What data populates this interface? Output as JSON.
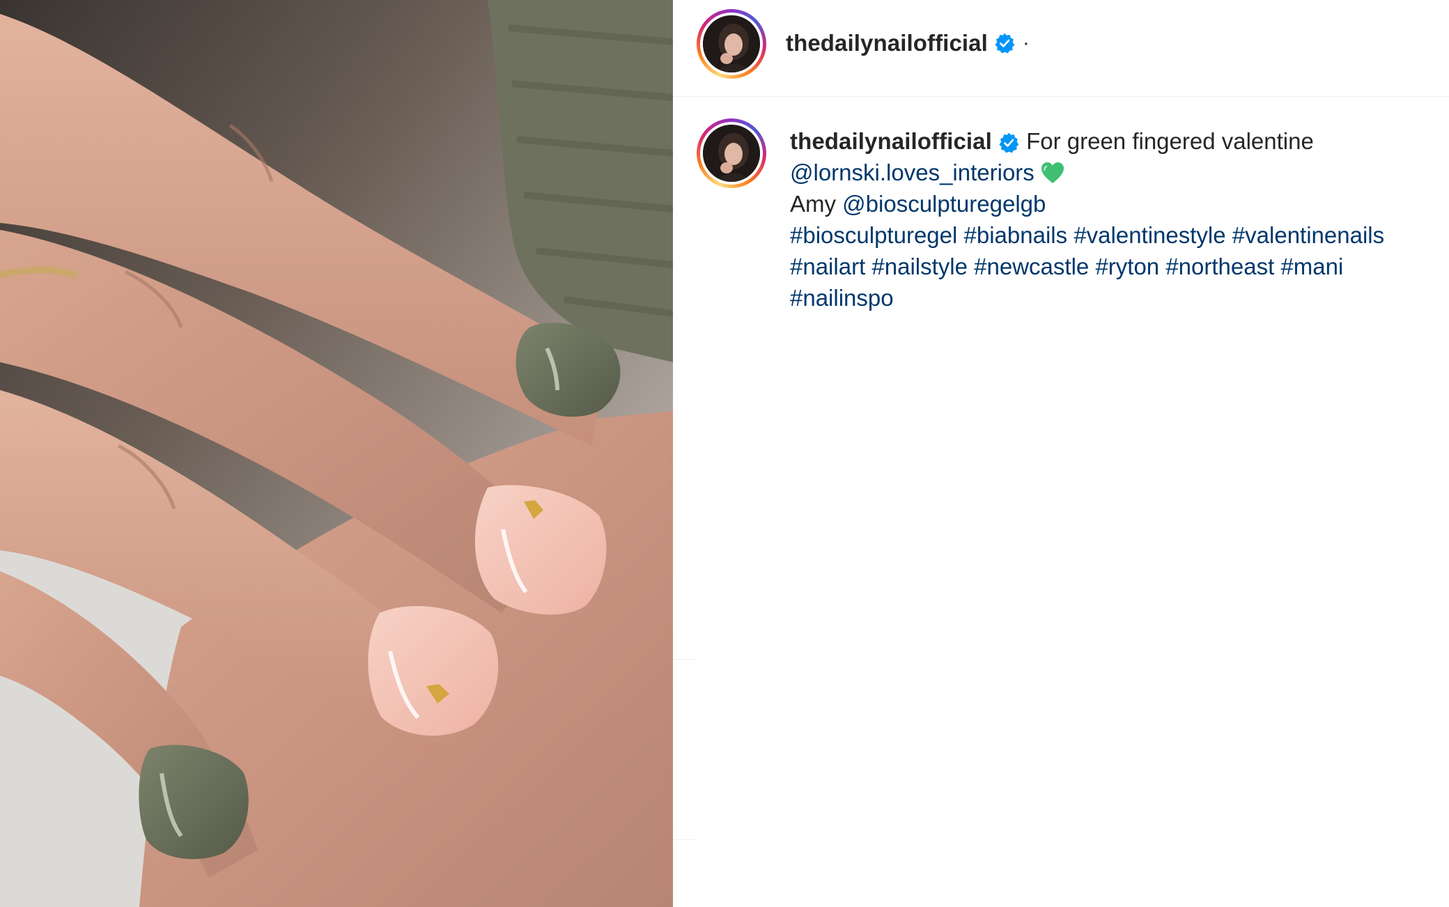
{
  "post": {
    "author": {
      "username": "thedailynailofficial",
      "verified": true,
      "avatar_icon": "profile-avatar-photo"
    },
    "header_separator": "·",
    "caption": {
      "lines": [
        [
          {
            "type": "username",
            "text": "thedailynailofficial"
          },
          {
            "type": "text",
            "text": " For green fingered valentine"
          }
        ],
        [
          {
            "type": "mention",
            "text": "@lornski.loves_interiors"
          },
          {
            "type": "emoji",
            "icon": "green-heart-icon"
          }
        ],
        [
          {
            "type": "text",
            "text": "Amy "
          },
          {
            "type": "mention",
            "text": "@biosculpturegelgb"
          }
        ],
        [
          {
            "type": "hashtag",
            "text": "#biosculpturegel"
          },
          {
            "type": "hashtag",
            "text": "#biabnails"
          },
          {
            "type": "hashtag",
            "text": "#valentinestyle"
          },
          {
            "type": "hashtag",
            "text": "#valentinenails"
          }
        ],
        [
          {
            "type": "hashtag",
            "text": "#nailart"
          },
          {
            "type": "hashtag",
            "text": "#nailstyle"
          },
          {
            "type": "hashtag",
            "text": "#newcastle"
          },
          {
            "type": "hashtag",
            "text": "#ryton"
          },
          {
            "type": "hashtag",
            "text": "#northeast"
          },
          {
            "type": "hashtag",
            "text": "#mani"
          }
        ],
        [
          {
            "type": "hashtag",
            "text": "#nailinspo"
          }
        ]
      ]
    },
    "image": {
      "subject_icon": "manicure-photo"
    }
  },
  "colors": {
    "username": "#262626",
    "link": "#00376b",
    "verified_badge": "#0095f6",
    "divider": "#efefef",
    "green_nail": "#6f7660",
    "pink_nail": "#f1c1b4"
  }
}
